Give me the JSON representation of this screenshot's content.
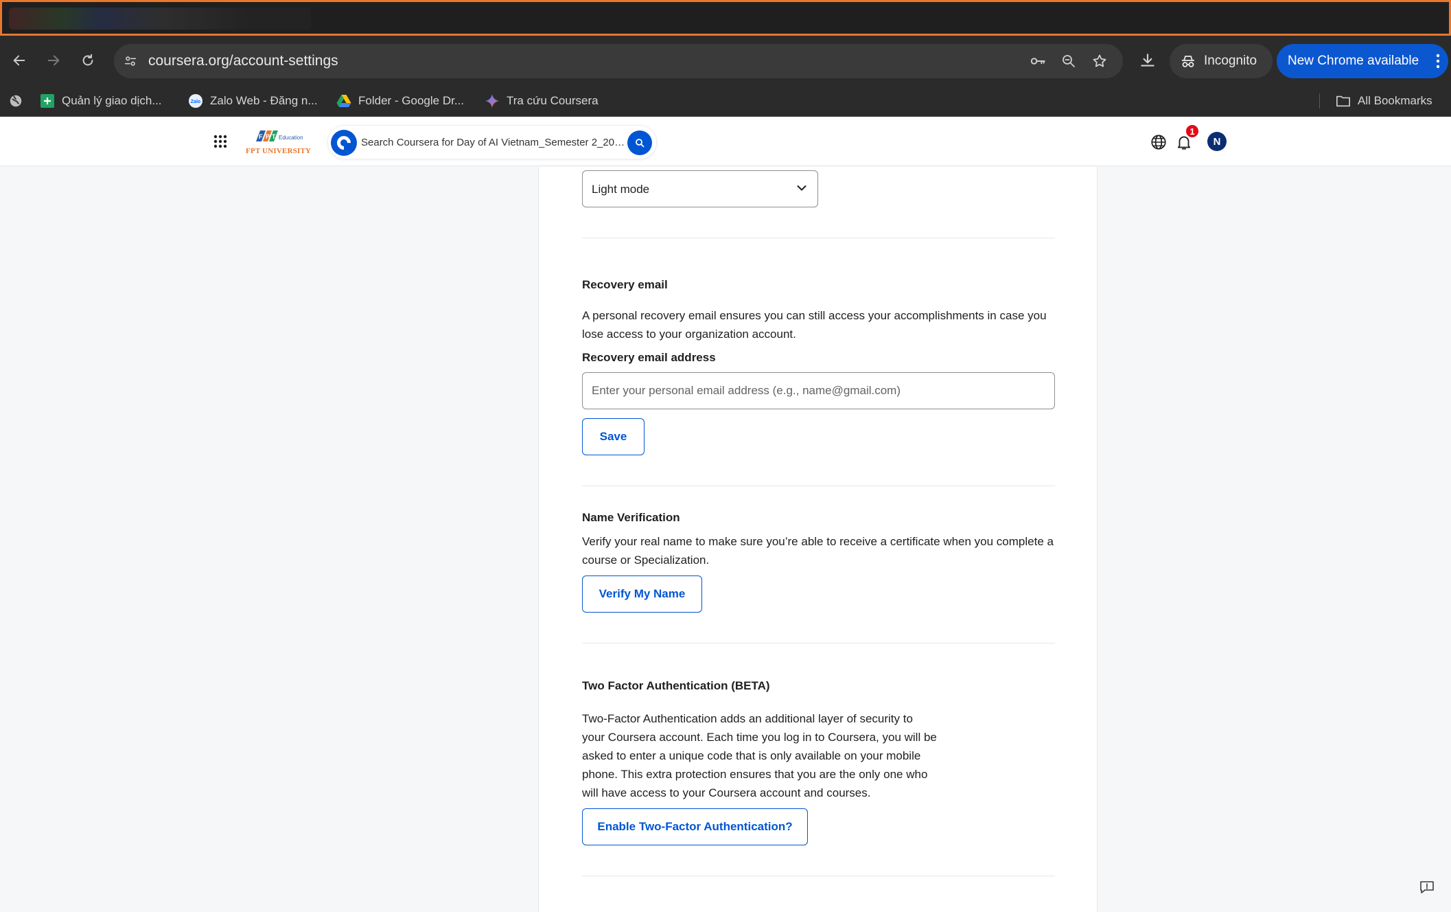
{
  "browser": {
    "url": "coursera.org/account-settings",
    "incognito_label": "Incognito",
    "new_chrome_label": "New Chrome available",
    "bookmarks": [
      {
        "label": "Quản lý giao dịch..."
      },
      {
        "label": "Zalo Web - Đăng n..."
      },
      {
        "label": "Folder - Google Dr..."
      },
      {
        "label": "Tra cứu Coursera"
      }
    ],
    "all_bookmarks_label": "All Bookmarks"
  },
  "header": {
    "logo_university": "FPT UNIVERSITY",
    "logo_edu": "Education",
    "search_placeholder": "Search Coursera for Day of AI Vietnam_Semester 2_2025...",
    "notification_count": "1",
    "avatar_initial": "N"
  },
  "settings": {
    "theme": {
      "selected": "Light mode"
    },
    "recovery": {
      "title": "Recovery email",
      "description_line1": "A personal recovery email ensures you can still access your accomplishments in case you",
      "description_line2": "lose access to your organization account.",
      "field_label": "Recovery email address",
      "placeholder": "Enter your personal email address (e.g., name@gmail.com)",
      "save_label": "Save"
    },
    "name_verification": {
      "title": "Name Verification",
      "description_line1": "Verify your real name to make sure you’re able to receive a certificate when you complete a",
      "description_line2": "course or Specialization.",
      "button_label": "Verify My Name"
    },
    "two_factor": {
      "title": "Two Factor Authentication (BETA)",
      "lines": [
        "Two-Factor Authentication adds an additional layer of security to",
        "your Coursera account. Each time you log in to Coursera, you will be",
        "asked to enter a unique code that is only available on your mobile",
        "phone. This extra protection ensures that you are the only one who",
        "will have access to your Coursera account and courses."
      ],
      "button_label": "Enable Two-Factor Authentication?"
    }
  },
  "colors": {
    "accent": "#0056d2",
    "badge": "#e30a17",
    "chrome_blue": "#0b57d0"
  }
}
